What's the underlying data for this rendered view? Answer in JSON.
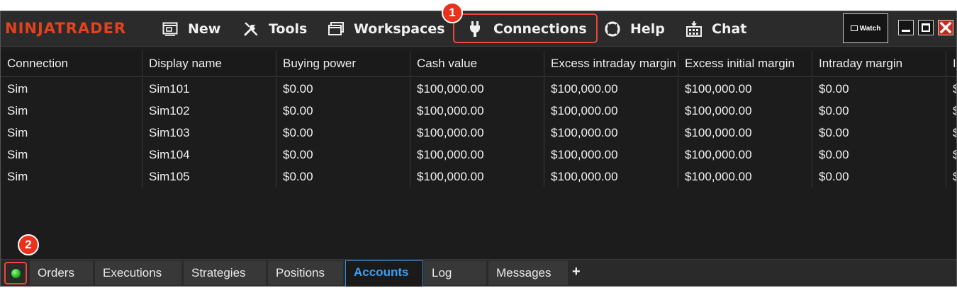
{
  "app": {
    "brand": "NINJATRADER"
  },
  "menu": {
    "new": "New",
    "tools": "Tools",
    "workspaces": "Workspaces",
    "connections": "Connections",
    "help": "Help",
    "chat": "Chat"
  },
  "toolbar": {
    "watch_label": "Watch"
  },
  "annotations": {
    "badge1": "1",
    "badge2": "2",
    "highlight_color": "#e8473b"
  },
  "colors": {
    "brand": "#e2421e",
    "active_tab": "#3aa0f5",
    "connected_status": "#1fb51f"
  },
  "grid": {
    "columns": [
      "Connection",
      "Display name",
      "Buying power",
      "Cash value",
      "Excess intraday margin",
      "Excess initial margin",
      "Intraday margin",
      "In"
    ],
    "rows": [
      [
        "Sim",
        "Sim101",
        "$0.00",
        "$100,000.00",
        "$100,000.00",
        "$100,000.00",
        "$0.00",
        "$"
      ],
      [
        "Sim",
        "Sim102",
        "$0.00",
        "$100,000.00",
        "$100,000.00",
        "$100,000.00",
        "$0.00",
        "$"
      ],
      [
        "Sim",
        "Sim103",
        "$0.00",
        "$100,000.00",
        "$100,000.00",
        "$100,000.00",
        "$0.00",
        "$"
      ],
      [
        "Sim",
        "Sim104",
        "$0.00",
        "$100,000.00",
        "$100,000.00",
        "$100,000.00",
        "$0.00",
        "$"
      ],
      [
        "Sim",
        "Sim105",
        "$0.00",
        "$100,000.00",
        "$100,000.00",
        "$100,000.00",
        "$0.00",
        "$"
      ]
    ]
  },
  "tabs": {
    "items": [
      "Orders",
      "Executions",
      "Strategies",
      "Positions",
      "Accounts",
      "Log",
      "Messages"
    ],
    "active": "Accounts",
    "add": "+"
  }
}
